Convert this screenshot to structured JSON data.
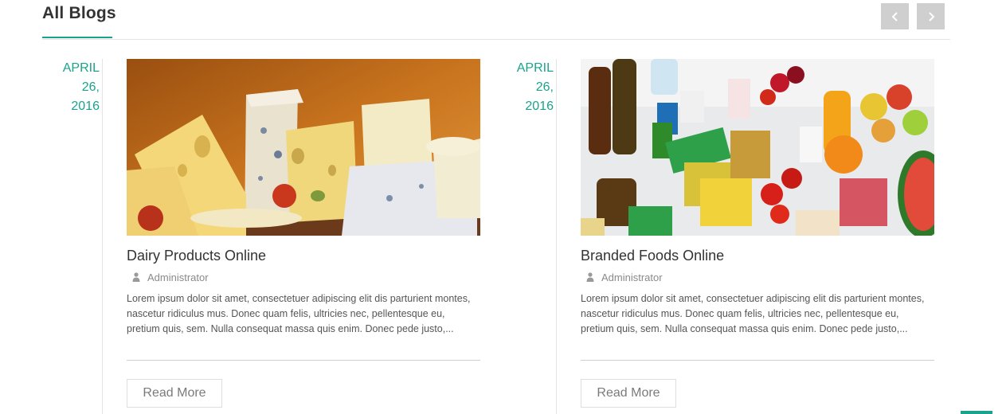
{
  "section": {
    "title": "All Blogs",
    "accent_color": "#1aa38c",
    "prev_icon": "chevron-left-icon",
    "next_icon": "chevron-right-icon"
  },
  "posts": [
    {
      "date_line1": "APRIL 26,",
      "date_line2": "2016",
      "image": "cheese-assortment-photo",
      "title": "Dairy Products Online",
      "author_icon": "user-icon",
      "author": "Administrator",
      "excerpt": "Lorem ipsum dolor sit amet, consectetuer adipiscing elit dis parturient montes, nascetur ridiculus mus. Donec quam felis, ultricies nec, pellentesque eu, pretium quis, sem. Nulla consequat massa quis enim. Donec pede justo,...",
      "button": "Read More"
    },
    {
      "date_line1": "APRIL 26,",
      "date_line2": "2016",
      "image": "groceries-spread-photo",
      "title": "Branded Foods Online",
      "author_icon": "user-icon",
      "author": "Administrator",
      "excerpt": "Lorem ipsum dolor sit amet, consectetuer adipiscing elit dis parturient montes, nascetur ridiculus mus. Donec quam felis, ultricies nec, pellentesque eu, pretium quis, sem. Nulla consequat massa quis enim. Donec pede justo,...",
      "button": "Read More"
    }
  ]
}
